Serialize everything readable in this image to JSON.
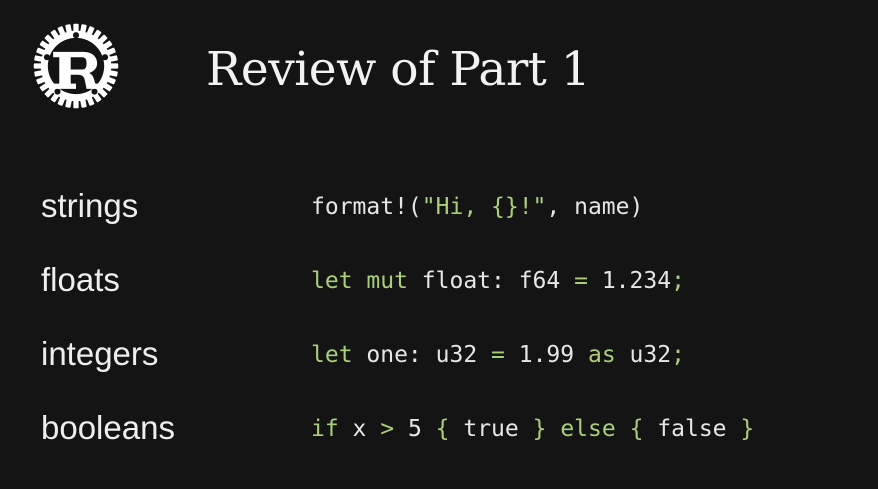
{
  "slide": {
    "title": "Review of Part 1"
  },
  "rows": [
    {
      "label": "strings",
      "code": [
        {
          "t": "format!(",
          "c": "pl"
        },
        {
          "t": "\"Hi, {}!\"",
          "c": "st"
        },
        {
          "t": ", name)",
          "c": "pl"
        }
      ]
    },
    {
      "label": "floats",
      "code": [
        {
          "t": "let mut",
          "c": "kw"
        },
        {
          "t": " float: f64 ",
          "c": "pl"
        },
        {
          "t": "=",
          "c": "kw"
        },
        {
          "t": " 1.234",
          "c": "pl"
        },
        {
          "t": ";",
          "c": "kw"
        }
      ]
    },
    {
      "label": "integers",
      "code": [
        {
          "t": "let",
          "c": "kw"
        },
        {
          "t": " one: u32 ",
          "c": "pl"
        },
        {
          "t": "=",
          "c": "kw"
        },
        {
          "t": " 1.99 ",
          "c": "pl"
        },
        {
          "t": "as",
          "c": "kw"
        },
        {
          "t": " u32",
          "c": "pl"
        },
        {
          "t": ";",
          "c": "kw"
        }
      ]
    },
    {
      "label": "booleans",
      "code": [
        {
          "t": "if",
          "c": "kw"
        },
        {
          "t": " x ",
          "c": "pl"
        },
        {
          "t": ">",
          "c": "kw"
        },
        {
          "t": " 5 ",
          "c": "pl"
        },
        {
          "t": "{",
          "c": "kw"
        },
        {
          "t": " true ",
          "c": "pl"
        },
        {
          "t": "}",
          "c": "kw"
        },
        {
          "t": " ",
          "c": "pl"
        },
        {
          "t": "else",
          "c": "kw"
        },
        {
          "t": " ",
          "c": "pl"
        },
        {
          "t": "{",
          "c": "kw"
        },
        {
          "t": " false ",
          "c": "pl"
        },
        {
          "t": "}",
          "c": "kw"
        }
      ]
    }
  ],
  "logo": {
    "icon": "rust-logo-icon"
  },
  "colors": {
    "background": "#141414",
    "text": "#ececec",
    "keyword": "#a9cf7a"
  }
}
